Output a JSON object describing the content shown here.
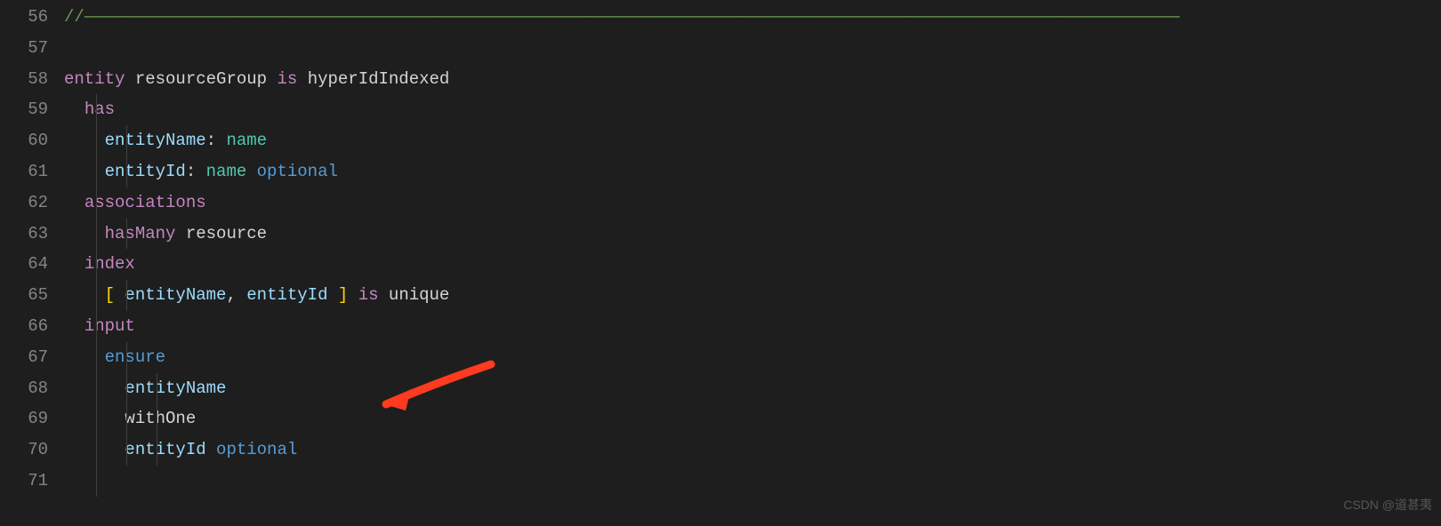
{
  "gutter": {
    "lines": [
      "56",
      "57",
      "58",
      "59",
      "60",
      "61",
      "62",
      "63",
      "64",
      "65",
      "66",
      "67",
      "68",
      "69",
      "70",
      "71"
    ]
  },
  "code": {
    "l56": {
      "comment_prefix": "//",
      "comment_dashes": "————————————————————————————————————————————————————————————————————————————————————————————————————————————"
    },
    "l58": {
      "kw_entity": "entity",
      "ident_resourceGroup": "resourceGroup",
      "kw_is": "is",
      "type_hyperIdIndexed": "hyperIdIndexed"
    },
    "l59": {
      "kw_has": "has"
    },
    "l60": {
      "field_entityName": "entityName",
      "colon": ":",
      "type_name": "name"
    },
    "l61": {
      "field_entityId": "entityId",
      "colon": ":",
      "type_name": "name",
      "mod_optional": "optional"
    },
    "l62": {
      "kw_associations": "associations"
    },
    "l63": {
      "kw_hasMany": "hasMany",
      "ident_resource": "resource"
    },
    "l64": {
      "kw_index": "index"
    },
    "l65": {
      "lb": "[",
      "f1": "entityName",
      "comma": ",",
      "f2": "entityId",
      "rb": "]",
      "kw_is": "is",
      "kw_unique": "unique"
    },
    "l66": {
      "kw_input": "input"
    },
    "l67": {
      "kw_ensure": "ensure"
    },
    "l68": {
      "field_entityName": "entityName"
    },
    "l69": {
      "field_withOne": "withOne"
    },
    "l70": {
      "field_entityId": "entityId",
      "mod_optional": "optional"
    }
  },
  "watermark": "CSDN @道甚夷",
  "annotation": {
    "arrow_name": "arrow-pointer-icon"
  }
}
